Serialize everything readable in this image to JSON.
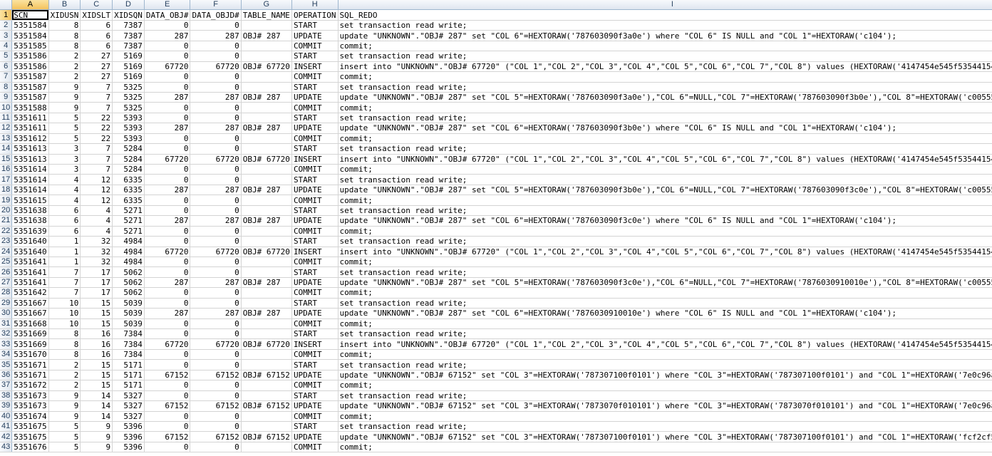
{
  "columns": [
    "A",
    "B",
    "C",
    "D",
    "E",
    "F",
    "G",
    "H",
    "I"
  ],
  "header_row": [
    "SCN",
    "XIDUSN",
    "XIDSLT",
    "XIDSQN",
    "DATA_OBJ#",
    "DATA_OBJD#",
    "TABLE_NAME",
    "OPERATION",
    "SQL_REDO"
  ],
  "rows": [
    [
      "5351584",
      "8",
      "6",
      "7387",
      "0",
      "0",
      "",
      "START",
      "set transaction read write;"
    ],
    [
      "5351584",
      "8",
      "6",
      "7387",
      "287",
      "287",
      "OBJ# 287",
      "UPDATE",
      "update \"UNKNOWN\".\"OBJ# 287\" set \"COL 6\"=HEXTORAW('787603090f3a0e') where \"COL 6\" IS NULL and \"COL 1\"=HEXTORAW('c104');"
    ],
    [
      "5351585",
      "8",
      "6",
      "7387",
      "0",
      "0",
      "",
      "COMMIT",
      "commit;"
    ],
    [
      "5351586",
      "2",
      "27",
      "5169",
      "0",
      "0",
      "",
      "START",
      "set transaction read write;"
    ],
    [
      "5351586",
      "2",
      "27",
      "5169",
      "67720",
      "67720",
      "OBJ# 67720",
      "INSERT",
      "insert into \"UNKNOWN\".\"OBJ# 67720\" (\"COL 1\",\"COL 2\",\"COL 3\",\"COL 4\",\"COL 5\",\"COL 6\",\"COL 7\",\"COL 8\") values (HEXTORAW('4147454e545f5354415455"
    ],
    [
      "5351587",
      "2",
      "27",
      "5169",
      "0",
      "0",
      "",
      "COMMIT",
      "commit;"
    ],
    [
      "5351587",
      "9",
      "7",
      "5325",
      "0",
      "0",
      "",
      "START",
      "set transaction read write;"
    ],
    [
      "5351587",
      "9",
      "7",
      "5325",
      "287",
      "287",
      "OBJ# 287",
      "UPDATE",
      "update \"UNKNOWN\".\"OBJ# 287\" set \"COL 5\"=HEXTORAW('787603090f3a0e'),\"COL 6\"=NULL,\"COL 7\"=HEXTORAW('787603090f3b0e'),\"COL 8\"=HEXTORAW('c0055532"
    ],
    [
      "5351588",
      "9",
      "7",
      "5325",
      "0",
      "0",
      "",
      "COMMIT",
      "commit;"
    ],
    [
      "5351611",
      "5",
      "22",
      "5393",
      "0",
      "0",
      "",
      "START",
      "set transaction read write;"
    ],
    [
      "5351611",
      "5",
      "22",
      "5393",
      "287",
      "287",
      "OBJ# 287",
      "UPDATE",
      "update \"UNKNOWN\".\"OBJ# 287\" set \"COL 6\"=HEXTORAW('787603090f3b0e') where \"COL 6\" IS NULL and \"COL 1\"=HEXTORAW('c104');"
    ],
    [
      "5351612",
      "5",
      "22",
      "5393",
      "0",
      "0",
      "",
      "COMMIT",
      "commit;"
    ],
    [
      "5351613",
      "3",
      "7",
      "5284",
      "0",
      "0",
      "",
      "START",
      "set transaction read write;"
    ],
    [
      "5351613",
      "3",
      "7",
      "5284",
      "67720",
      "67720",
      "OBJ# 67720",
      "INSERT",
      "insert into \"UNKNOWN\".\"OBJ# 67720\" (\"COL 1\",\"COL 2\",\"COL 3\",\"COL 4\",\"COL 5\",\"COL 6\",\"COL 7\",\"COL 8\") values (HEXTORAW('4147454e545f5354415455"
    ],
    [
      "5351614",
      "3",
      "7",
      "5284",
      "0",
      "0",
      "",
      "COMMIT",
      "commit;"
    ],
    [
      "5351614",
      "4",
      "12",
      "6335",
      "0",
      "0",
      "",
      "START",
      "set transaction read write;"
    ],
    [
      "5351614",
      "4",
      "12",
      "6335",
      "287",
      "287",
      "OBJ# 287",
      "UPDATE",
      "update \"UNKNOWN\".\"OBJ# 287\" set \"COL 5\"=HEXTORAW('787603090f3b0e'),\"COL 6\"=NULL,\"COL 7\"=HEXTORAW('787603090f3c0e'),\"COL 8\"=HEXTORAW('c0055532"
    ],
    [
      "5351615",
      "4",
      "12",
      "6335",
      "0",
      "0",
      "",
      "COMMIT",
      "commit;"
    ],
    [
      "5351638",
      "6",
      "4",
      "5271",
      "0",
      "0",
      "",
      "START",
      "set transaction read write;"
    ],
    [
      "5351638",
      "6",
      "4",
      "5271",
      "287",
      "287",
      "OBJ# 287",
      "UPDATE",
      "update \"UNKNOWN\".\"OBJ# 287\" set \"COL 6\"=HEXTORAW('787603090f3c0e') where \"COL 6\" IS NULL and \"COL 1\"=HEXTORAW('c104');"
    ],
    [
      "5351639",
      "6",
      "4",
      "5271",
      "0",
      "0",
      "",
      "COMMIT",
      "commit;"
    ],
    [
      "5351640",
      "1",
      "32",
      "4984",
      "0",
      "0",
      "",
      "START",
      "set transaction read write;"
    ],
    [
      "5351640",
      "1",
      "32",
      "4984",
      "67720",
      "67720",
      "OBJ# 67720",
      "INSERT",
      "insert into \"UNKNOWN\".\"OBJ# 67720\" (\"COL 1\",\"COL 2\",\"COL 3\",\"COL 4\",\"COL 5\",\"COL 6\",\"COL 7\",\"COL 8\") values (HEXTORAW('4147454e545f5354415455"
    ],
    [
      "5351641",
      "1",
      "32",
      "4984",
      "0",
      "0",
      "",
      "COMMIT",
      "commit;"
    ],
    [
      "5351641",
      "7",
      "17",
      "5062",
      "0",
      "0",
      "",
      "START",
      "set transaction read write;"
    ],
    [
      "5351641",
      "7",
      "17",
      "5062",
      "287",
      "287",
      "OBJ# 287",
      "UPDATE",
      "update \"UNKNOWN\".\"OBJ# 287\" set \"COL 5\"=HEXTORAW('787603090f3c0e'),\"COL 6\"=NULL,\"COL 7\"=HEXTORAW('7876030910010e'),\"COL 8\"=HEXTORAW('c0055532"
    ],
    [
      "5351642",
      "7",
      "17",
      "5062",
      "0",
      "0",
      "",
      "COMMIT",
      "commit;"
    ],
    [
      "5351667",
      "10",
      "15",
      "5039",
      "0",
      "0",
      "",
      "START",
      "set transaction read write;"
    ],
    [
      "5351667",
      "10",
      "15",
      "5039",
      "287",
      "287",
      "OBJ# 287",
      "UPDATE",
      "update \"UNKNOWN\".\"OBJ# 287\" set \"COL 6\"=HEXTORAW('7876030910010e') where \"COL 6\" IS NULL and \"COL 1\"=HEXTORAW('c104');"
    ],
    [
      "5351668",
      "10",
      "15",
      "5039",
      "0",
      "0",
      "",
      "COMMIT",
      "commit;"
    ],
    [
      "5351669",
      "8",
      "16",
      "7384",
      "0",
      "0",
      "",
      "START",
      "set transaction read write;"
    ],
    [
      "5351669",
      "8",
      "16",
      "7384",
      "67720",
      "67720",
      "OBJ# 67720",
      "INSERT",
      "insert into \"UNKNOWN\".\"OBJ# 67720\" (\"COL 1\",\"COL 2\",\"COL 3\",\"COL 4\",\"COL 5\",\"COL 6\",\"COL 7\",\"COL 8\") values (HEXTORAW('4147454e545f5354415455"
    ],
    [
      "5351670",
      "8",
      "16",
      "7384",
      "0",
      "0",
      "",
      "COMMIT",
      "commit;"
    ],
    [
      "5351671",
      "2",
      "15",
      "5171",
      "0",
      "0",
      "",
      "START",
      "set transaction read write;"
    ],
    [
      "5351671",
      "2",
      "15",
      "5171",
      "67152",
      "67152",
      "OBJ# 67152",
      "UPDATE",
      "update \"UNKNOWN\".\"OBJ# 67152\" set \"COL 3\"=HEXTORAW('787307100f0101') where \"COL 3\"=HEXTORAW('787307100f0101') and \"COL 1\"=HEXTORAW('7e0c96ae3"
    ],
    [
      "5351672",
      "2",
      "15",
      "5171",
      "0",
      "0",
      "",
      "COMMIT",
      "commit;"
    ],
    [
      "5351673",
      "9",
      "14",
      "5327",
      "0",
      "0",
      "",
      "START",
      "set transaction read write;"
    ],
    [
      "5351673",
      "9",
      "14",
      "5327",
      "67152",
      "67152",
      "OBJ# 67152",
      "UPDATE",
      "update \"UNKNOWN\".\"OBJ# 67152\" set \"COL 3\"=HEXTORAW('7873070f010101') where \"COL 3\"=HEXTORAW('7873070f010101') and \"COL 1\"=HEXTORAW('7e0c96ae3"
    ],
    [
      "5351674",
      "9",
      "14",
      "5327",
      "0",
      "0",
      "",
      "COMMIT",
      "commit;"
    ],
    [
      "5351675",
      "5",
      "9",
      "5396",
      "0",
      "0",
      "",
      "START",
      "set transaction read write;"
    ],
    [
      "5351675",
      "5",
      "9",
      "5396",
      "67152",
      "67152",
      "OBJ# 67152",
      "UPDATE",
      "update \"UNKNOWN\".\"OBJ# 67152\" set \"COL 3\"=HEXTORAW('787307100f0101') where \"COL 3\"=HEXTORAW('787307100f0101') and \"COL 1\"=HEXTORAW('fcf2cf5f1"
    ],
    [
      "5351676",
      "5",
      "9",
      "5396",
      "0",
      "0",
      "",
      "COMMIT",
      "commit;"
    ]
  ]
}
